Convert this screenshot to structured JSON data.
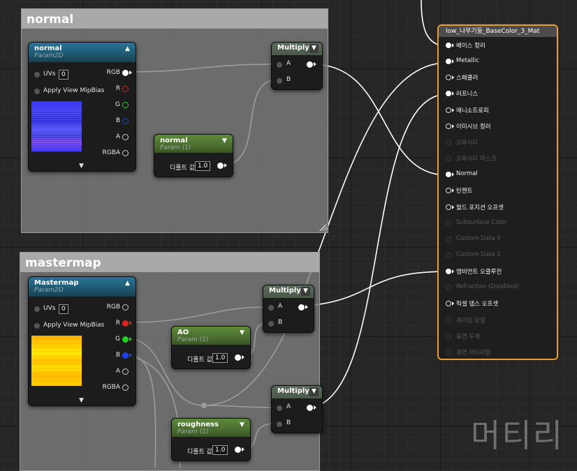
{
  "comments": {
    "normal_title": "normal",
    "mastermap_title": "mastermap"
  },
  "tex_normal": {
    "title": "normal",
    "subtitle": "Param2D",
    "uvs_label": "UVs",
    "uvs_value": "0",
    "mip_label": "Apply View MipBias",
    "out_rgb": "RGB",
    "out_r": "R",
    "out_g": "G",
    "out_b": "B",
    "out_a": "A",
    "out_rgba": "RGBA"
  },
  "tex_master": {
    "title": "Mastermap",
    "subtitle": "Param2D",
    "uvs_label": "UVs",
    "uvs_value": "0",
    "mip_label": "Apply View MipBias",
    "out_rgb": "RGB",
    "out_r": "R",
    "out_g": "G",
    "out_b": "B",
    "out_a": "A",
    "out_rgba": "RGBA"
  },
  "param_normal": {
    "title": "normal",
    "subtitle": "Param (1)",
    "default_label": "디폴트 값",
    "default_value": "1.0"
  },
  "param_ao": {
    "title": "AO",
    "subtitle": "Param (1)",
    "default_label": "디폴트 값",
    "default_value": "1.0"
  },
  "param_rough": {
    "title": "roughness",
    "subtitle": "Param (1)",
    "default_label": "디폴트 값",
    "default_value": "1.0"
  },
  "multiply": {
    "title": "Multiply",
    "in_a": "A",
    "in_b": "B"
  },
  "result": {
    "title": "low_나무기둥_BaseColor_3_Mat",
    "pins": [
      {
        "label": "베이스 컬러",
        "connected": true,
        "enabled": true
      },
      {
        "label": "Metallic",
        "connected": true,
        "enabled": true
      },
      {
        "label": "스페큘러",
        "connected": false,
        "enabled": true
      },
      {
        "label": "러프니스",
        "connected": true,
        "enabled": true
      },
      {
        "label": "애니소트로피",
        "connected": false,
        "enabled": true
      },
      {
        "label": "이미시브 컬러",
        "connected": false,
        "enabled": true
      },
      {
        "label": "오파시티",
        "connected": false,
        "enabled": false
      },
      {
        "label": "오파시티 마스크",
        "connected": false,
        "enabled": false
      },
      {
        "label": "Normal",
        "connected": true,
        "enabled": true
      },
      {
        "label": "탄젠트",
        "connected": false,
        "enabled": true
      },
      {
        "label": "월드 포지션 오프셋",
        "connected": false,
        "enabled": true
      },
      {
        "label": "Subsurface Color",
        "connected": false,
        "enabled": false
      },
      {
        "label": "Custom Data 0",
        "connected": false,
        "enabled": false
      },
      {
        "label": "Custom Data 1",
        "connected": false,
        "enabled": false
      },
      {
        "label": "앰비언트 오클루전",
        "connected": true,
        "enabled": true
      },
      {
        "label": "Refraction (Disabled)",
        "connected": false,
        "enabled": false
      },
      {
        "label": "픽셀 뎁스 오프셋",
        "connected": false,
        "enabled": true
      },
      {
        "label": "셰이딩 모델",
        "connected": false,
        "enabled": false
      },
      {
        "label": "표면 두께",
        "connected": false,
        "enabled": false
      },
      {
        "label": "경면 머티리얼",
        "connected": false,
        "enabled": false
      }
    ]
  },
  "watermark": "머티리",
  "colors": {
    "result_border": "#e8a030",
    "pin_red": "#e02020",
    "pin_green": "#20d020",
    "pin_blue": "#2040ff",
    "texture_header": "#1e5870",
    "param_header": "#4a6d2f"
  },
  "icons": {
    "collapse": "chevron-up-icon",
    "expand": "chevron-down-icon",
    "multiply_menu": "chevron-down-icon"
  }
}
